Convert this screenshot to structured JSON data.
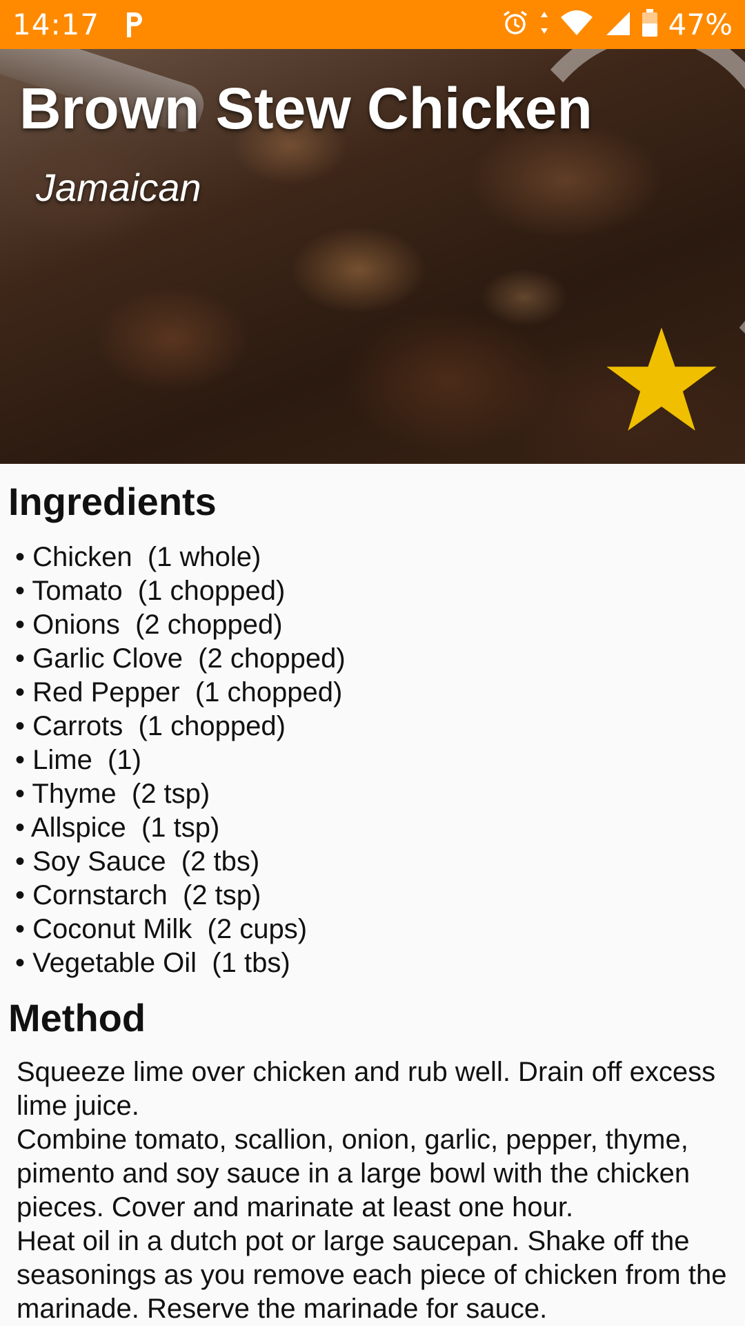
{
  "status_bar": {
    "time": "14:17",
    "battery": "47%",
    "icons": [
      "parking-icon",
      "alarm-icon",
      "data-arrows-icon",
      "wifi-icon",
      "cell-signal-icon",
      "battery-icon"
    ],
    "background_color": "#ff8a00"
  },
  "recipe": {
    "title": "Brown Stew Chicken",
    "area": "Jamaican",
    "favorite_color": "#f0c000"
  },
  "ingredients": {
    "heading": "Ingredients",
    "items": [
      "• Chicken  (1 whole)",
      "• Tomato  (1 chopped)",
      "• Onions  (2 chopped)",
      "• Garlic Clove  (2 chopped)",
      "• Red Pepper  (1 chopped)",
      "• Carrots  (1 chopped)",
      "• Lime  (1)",
      "• Thyme  (2 tsp)",
      "• Allspice  (1 tsp)",
      "• Soy Sauce  (2 tbs)",
      "• Cornstarch  (2 tsp)",
      "• Coconut Milk  (2 cups)",
      "• Vegetable Oil  (1 tbs)"
    ]
  },
  "method": {
    "heading": "Method",
    "paragraphs": [
      "Squeeze lime over chicken and rub well. Drain off excess lime juice.",
      "Combine tomato, scallion, onion, garlic, pepper, thyme, pimento and soy sauce in a large bowl with the chicken pieces. Cover and marinate at least one hour.",
      "Heat oil in a dutch pot or large saucepan. Shake off the seasonings as you remove each piece of chicken from the marinade. Reserve the marinade for sauce."
    ]
  }
}
